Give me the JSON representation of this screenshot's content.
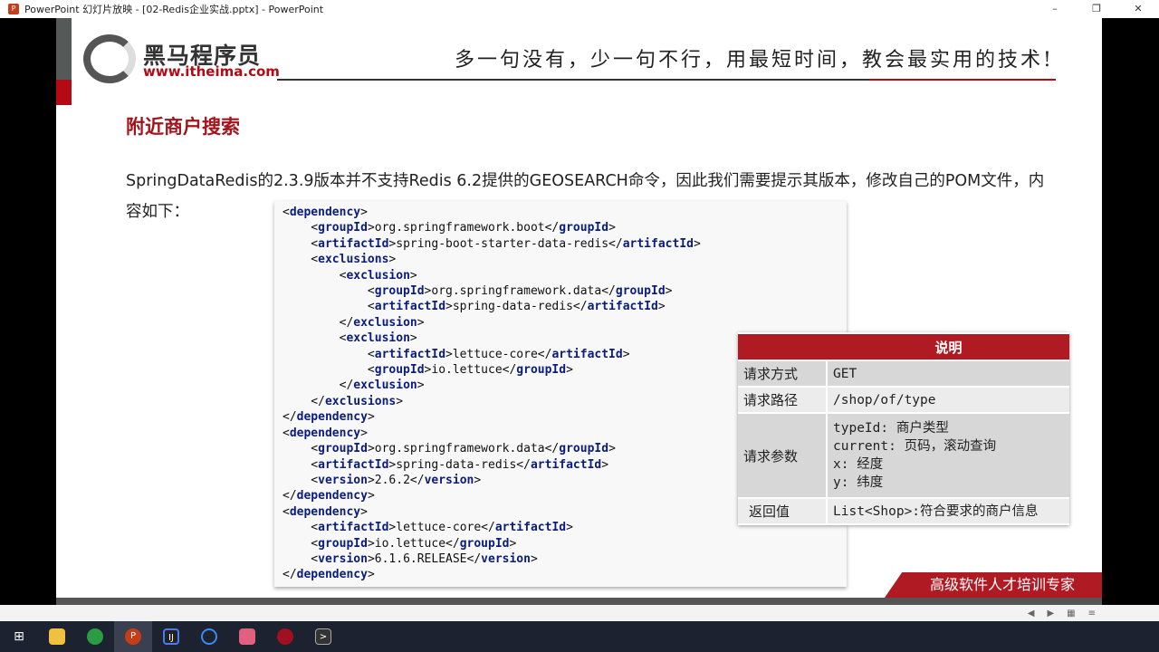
{
  "window": {
    "title": "PowerPoint 幻灯片放映 - [02-Redis企业实战.pptx] - PowerPoint"
  },
  "slide": {
    "logo_cn": "黑马程序员",
    "logo_url": "www.itheima.com",
    "slogan": "多一句没有，少一句不行，用最短时间，教会最实用的技术!",
    "heading": "附近商户搜索",
    "paragraph": "SpringDataRedis的2.3.9版本并不支持Redis 6.2提供的GEOSEARCH命令，因此我们需要提示其版本，修改自己的POM文件，内容如下：",
    "code_lines": [
      "<dependency>",
      "    <groupId>org.springframework.boot</groupId>",
      "    <artifactId>spring-boot-starter-data-redis</artifactId>",
      "    <exclusions>",
      "        <exclusion>",
      "            <groupId>org.springframework.data</groupId>",
      "            <artifactId>spring-data-redis</artifactId>",
      "        </exclusion>",
      "        <exclusion>",
      "            <artifactId>lettuce-core</artifactId>",
      "            <groupId>io.lettuce</groupId>",
      "        </exclusion>",
      "    </exclusions>",
      "</dependency>",
      "<dependency>",
      "    <groupId>org.springframework.data</groupId>",
      "    <artifactId>spring-data-redis</artifactId>",
      "    <version>2.6.2</version>",
      "</dependency>",
      "<dependency>",
      "    <artifactId>lettuce-core</artifactId>",
      "    <groupId>io.lettuce</groupId>",
      "    <version>6.1.6.RELEASE</version>",
      "</dependency>"
    ],
    "table": {
      "header": [
        "",
        "说明"
      ],
      "rows": [
        {
          "key": "请求方式",
          "value": "GET"
        },
        {
          "key": "请求路径",
          "value": "/shop/of/type"
        },
        {
          "key": "请求参数",
          "value": "typeId: 商户类型\ncurrent: 页码，滚动查询\nx: 经度\ny: 纬度"
        },
        {
          "key": "返回值",
          "value": "List<Shop>:符合要求的商户信息"
        }
      ]
    },
    "footer": "高级软件人才培训专家"
  },
  "taskbar": {
    "apps": [
      "start",
      "file-explorer",
      "chrome",
      "powerpoint",
      "intellij",
      "app-blue",
      "app-typora",
      "app-redis",
      "app-terminal"
    ]
  }
}
